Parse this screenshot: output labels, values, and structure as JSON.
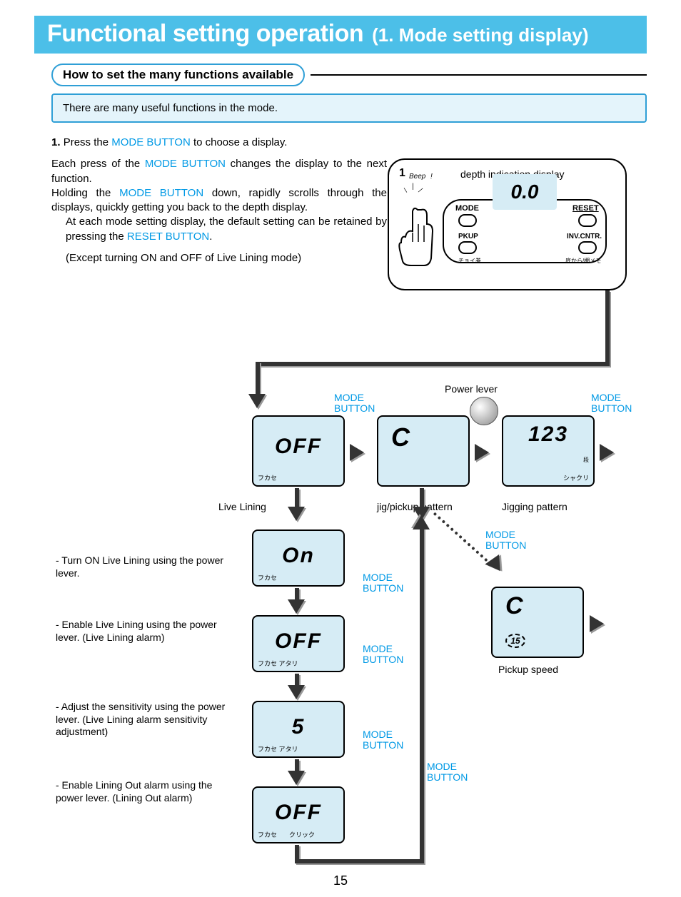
{
  "title": {
    "main": "Functional setting operation",
    "sub": "(1. Mode setting display)"
  },
  "subhead": "How to set the many functions available",
  "intro": "There are many useful functions in the mode.",
  "step1": {
    "num": "1.",
    "a": "Press the ",
    "mb": "MODE BUTTON",
    "b": " to choose a display."
  },
  "para1": {
    "a": "Each press of the ",
    "mb": "MODE BUTTON",
    "b": " changes the display to the next function."
  },
  "para2": {
    "a": "Holding the ",
    "mb": "MODE BUTTON",
    "b": " down, rapidly scrolls through the displays, quickly getting you back to the depth display."
  },
  "para3": {
    "a": "At each mode setting display, the default setting can be retained by pressing the ",
    "rb": "RESET BUTTON",
    "b": "."
  },
  "para4": "(Except turning ON and OFF of  Live Lining mode)",
  "device": {
    "beep": "Beep",
    "num_label": "1",
    "depth_label": "depth indication display",
    "mode": "MODE",
    "reset": "RESET",
    "pkup": "PKUP",
    "inv": "INV.CNTR.",
    "lcd": "0.0",
    "jp1": "チョイ巻",
    "jp2": "底から/棚メモ"
  },
  "flow": {
    "mode_button": "MODE\nBUTTON",
    "power_lever": "Power lever",
    "live_lining": "Live Lining",
    "jig_pickup": "jig/pickup pattern",
    "jigging": "Jigging pattern",
    "pickup_speed": "Pickup speed",
    "lcd_off": "OFF",
    "lcd_on": "On",
    "lcd_c": "C",
    "lcd_123": "123",
    "lcd_5": "5",
    "lcd_c15": "15",
    "jp_fukase": "フカセ",
    "jp_atari": "フカセ アタリ",
    "jp_click": "クリック",
    "jp_dan": "段",
    "jp_shakuri": "シャクリ"
  },
  "notes": {
    "n1": "- Turn ON Live Lining using the power lever.",
    "n2": "- Enable Live Lining using the power lever. (Live Lining alarm)",
    "n3": "- Adjust the sensitivity using the power lever. (Live Lining alarm sensitivity adjustment)",
    "n4": "- Enable Lining Out alarm using the power lever. (Lining Out alarm)"
  },
  "page": "15"
}
